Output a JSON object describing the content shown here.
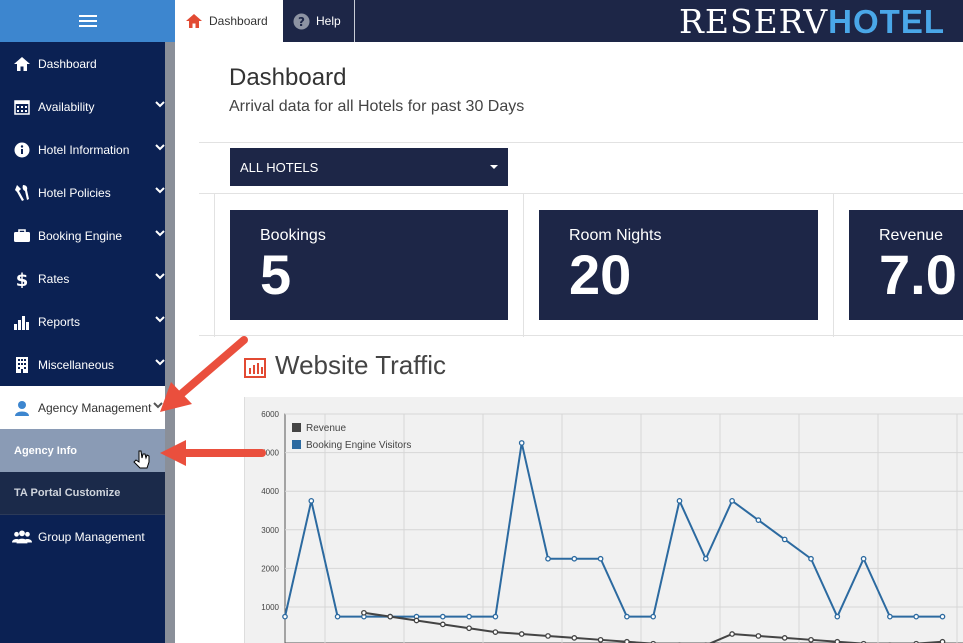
{
  "app": {
    "logo_text_left": "RESERV",
    "logo_text_right": "HOTEL"
  },
  "tabs": [
    {
      "label": "Dashboard",
      "icon": "home-icon"
    },
    {
      "label": "Help",
      "icon": "help-circle-icon"
    }
  ],
  "sidebar": {
    "items": [
      {
        "label": "Dashboard",
        "icon": "home-icon",
        "has_chevron": false
      },
      {
        "label": "Availability",
        "icon": "calendar-icon",
        "has_chevron": true
      },
      {
        "label": "Hotel Information",
        "icon": "info-icon",
        "has_chevron": true
      },
      {
        "label": "Hotel Policies",
        "icon": "tools-icon",
        "has_chevron": true
      },
      {
        "label": "Booking Engine",
        "icon": "briefcase-icon",
        "has_chevron": true
      },
      {
        "label": "Rates",
        "icon": "dollar-icon",
        "has_chevron": true
      },
      {
        "label": "Reports",
        "icon": "bar-chart-icon",
        "has_chevron": true
      },
      {
        "label": "Miscellaneous",
        "icon": "building-icon",
        "has_chevron": true
      },
      {
        "label": "Agency Management",
        "icon": "user-icon",
        "has_chevron": true
      }
    ],
    "subitems": [
      {
        "label": "Agency Info"
      },
      {
        "label": "TA Portal Customize"
      }
    ],
    "last_item": {
      "label": "Group Management",
      "icon": "users-icon"
    }
  },
  "main": {
    "title": "Dashboard",
    "subtitle": "Arrival data for all Hotels for past 30 Days",
    "hotel_select": {
      "value": "ALL HOTELS"
    },
    "stats": [
      {
        "label": "Bookings",
        "value": "5"
      },
      {
        "label": "Room Nights",
        "value": "20"
      },
      {
        "label": "Revenue",
        "value": "7.0"
      }
    ],
    "traffic_title": "Website Traffic"
  },
  "colors": {
    "sidebar": "#0b2153",
    "accent": "#3d86cf",
    "navy": "#1d2647",
    "series_visitors": "#2c6aa0",
    "series_revenue": "#444444",
    "arrow": "#ea4f3d"
  },
  "chart_data": {
    "type": "line",
    "legend": [
      "Revenue",
      "Booking Engine Visitors"
    ],
    "y_ticks": [
      "6000",
      "5000",
      "4000",
      "3000",
      "2000",
      "1000"
    ],
    "ylim": [
      0,
      6000
    ],
    "x_count": 26,
    "series": [
      {
        "name": "Booking Engine Visitors",
        "values": [
          750,
          3750,
          750,
          750,
          750,
          750,
          750,
          750,
          750,
          5250,
          2250,
          2250,
          2250,
          750,
          750,
          3750,
          2250,
          3750,
          3250,
          2750,
          2250,
          750,
          2250,
          750,
          750,
          750
        ]
      },
      {
        "name": "Revenue",
        "values": [
          null,
          null,
          null,
          850,
          750,
          650,
          550,
          450,
          350,
          300,
          250,
          200,
          150,
          100,
          50,
          10,
          10,
          300,
          250,
          200,
          150,
          100,
          50,
          10,
          50,
          100
        ]
      }
    ]
  }
}
